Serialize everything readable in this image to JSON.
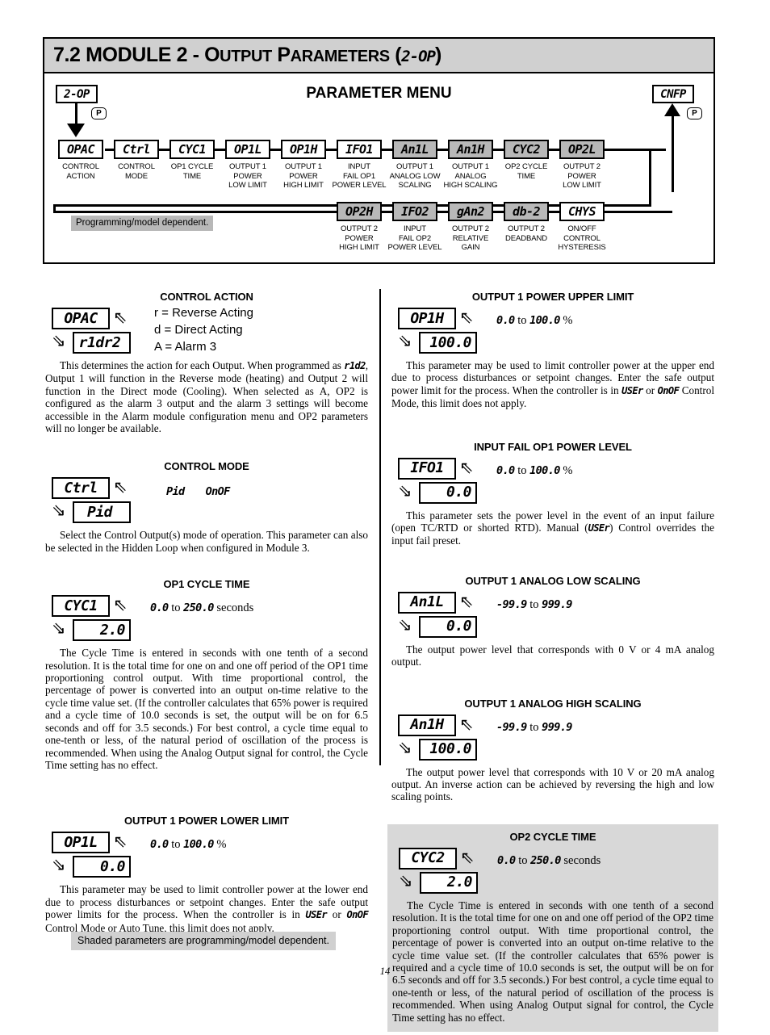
{
  "header": {
    "number": "7.2",
    "title_main": "MODULE 2 - ",
    "title_sc1": "O",
    "title_sc1b": "UTPUT",
    "title_sc2": "P",
    "title_sc2b": "ARAMETERS",
    "paren_open": "(",
    "code": "2-OP",
    "paren_close": ")"
  },
  "diagram": {
    "title": "PARAMETER MENU",
    "entry_box": "2-OP",
    "exit_box": "CNFP",
    "p_button": "P",
    "note": "Programming/model dependent.",
    "row1": [
      {
        "code": "OPAC",
        "label": "CONTROL\nACTION",
        "shaded": false
      },
      {
        "code": "Ctrl",
        "label": "CONTROL\nMODE",
        "shaded": false
      },
      {
        "code": "CYC1",
        "label": "OP1 CYCLE\nTIME",
        "shaded": false
      },
      {
        "code": "OP1L",
        "label": "OUTPUT 1\nPOWER\nLOW LIMIT",
        "shaded": false
      },
      {
        "code": "OP1H",
        "label": "OUTPUT 1\nPOWER\nHIGH LIMIT",
        "shaded": false
      },
      {
        "code": "IFO1",
        "label": "INPUT\nFAIL OP1\nPOWER LEVEL",
        "shaded": false
      },
      {
        "code": "An1L",
        "label": "OUTPUT 1\nANALOG LOW\nSCALING",
        "shaded": true
      },
      {
        "code": "An1H",
        "label": "OUTPUT 1\nANALOG\nHIGH SCALING",
        "shaded": true
      },
      {
        "code": "CYC2",
        "label": "OP2 CYCLE\nTIME",
        "shaded": true
      },
      {
        "code": "OP2L",
        "label": "OUTPUT 2\nPOWER\nLOW LIMIT",
        "shaded": true
      }
    ],
    "row2": [
      {
        "code": "OP2H",
        "label": "OUTPUT 2\nPOWER\nHIGH LIMIT",
        "shaded": true
      },
      {
        "code": "IFO2",
        "label": "INPUT\nFAIL OP2\nPOWER LEVEL",
        "shaded": true
      },
      {
        "code": "gAn2",
        "label": "OUTPUT 2\nRELATIVE\nGAIN",
        "shaded": true
      },
      {
        "code": "db-2",
        "label": "OUTPUT 2\nDEADBAND",
        "shaded": true
      },
      {
        "code": "CHYS",
        "label": "ON/OFF\nCONTROL\nHYSTERESIS",
        "shaded": false
      }
    ]
  },
  "sections": {
    "control_action": {
      "title": "CONTROL ACTION",
      "param_name": "OPAC",
      "param_value": "r1dr2",
      "choices": [
        "r = Reverse Acting",
        "d = Direct Acting",
        "A = Alarm 3"
      ],
      "body_a": "This determines the action for each Output. When programmed as ",
      "body_code": "r1d2",
      "body_b": ", Output 1 will function in the Reverse mode (heating) and Output 2 will function in the Direct mode (Cooling). When selected as A, OP2 is configured as the alarm 3 output and the alarm 3 settings will become accessible in the Alarm module configuration menu and OP2 parameters will no longer be available."
    },
    "control_mode": {
      "title": "CONTROL MODE",
      "param_name": "Ctrl",
      "param_value": "Pid",
      "options": [
        "Pid",
        "OnOF"
      ],
      "body": "Select the Control Output(s) mode of operation. This parameter can also be selected in the Hidden Loop when configured in Module 3."
    },
    "op1_cycle_time": {
      "title": "OP1 CYCLE TIME",
      "param_name": "CYC1",
      "param_value": "2.0",
      "range_low": "0.0",
      "range_mid": " to ",
      "range_high": "250.0",
      "range_unit": " seconds",
      "body": "The Cycle Time is entered in seconds with one tenth of a second resolution. It is the total time for one on and one off period of the OP1 time proportioning control output. With time proportional control, the percentage of power is converted into an output on-time relative to the cycle time value set. (If the controller calculates that 65% power is required and a cycle time of 10.0 seconds is set, the output will be on for 6.5 seconds and off for 3.5 seconds.) For best control, a cycle time equal to one-tenth or less, of the natural period of oscillation of the process is recommended. When using the Analog Output signal for control, the Cycle Time setting has no effect."
    },
    "op1_power_lower": {
      "title": "OUTPUT 1 POWER LOWER LIMIT",
      "param_name": "OP1L",
      "param_value": "0.0",
      "range_low": "0.0",
      "range_mid": " to ",
      "range_high": "100.0",
      "range_unit": " %",
      "body_a": "This parameter may be used to limit controller power at the lower end due to process disturbances or setpoint changes. Enter the safe output power limits for the process. When the controller is in ",
      "body_code1": "USEr",
      "body_b": " or ",
      "body_code2": "OnOF",
      "body_c": " Control Mode or Auto Tune, this limit does not apply."
    },
    "op1_power_upper": {
      "title": "OUTPUT 1 POWER UPPER LIMIT",
      "param_name": "OP1H",
      "param_value": "100.0",
      "range_low": "0.0",
      "range_mid": " to ",
      "range_high": "100.0",
      "range_unit": " %",
      "body_a": "This parameter may be used to limit controller power at the upper end due to process disturbances or setpoint changes. Enter the safe output power limit for the process. When the controller is in ",
      "body_code1": "USEr",
      "body_b": " or ",
      "body_code2": "OnOF",
      "body_c": " Control Mode, this limit does not apply."
    },
    "input_fail_op1": {
      "title": "INPUT FAIL OP1 POWER LEVEL",
      "param_name": "IFO1",
      "param_value": "0.0",
      "range_low": "0.0",
      "range_mid": " to ",
      "range_high": "100.0",
      "range_unit": " %",
      "body_a": "This parameter sets the power level in the event of an input failure (open TC/RTD or shorted RTD). Manual (",
      "body_code1": "USEr",
      "body_b": ") Control overrides the input fail preset."
    },
    "analog_low": {
      "title": "OUTPUT 1 ANALOG LOW SCALING",
      "param_name": "An1L",
      "param_value": "0.0",
      "range_low": "-99.9",
      "range_mid": " to ",
      "range_high": "999.9",
      "range_unit": "",
      "body": "The output power level that corresponds with 0 V or 4 mA analog output."
    },
    "analog_high": {
      "title": "OUTPUT 1 ANALOG HIGH SCALING",
      "param_name": "An1H",
      "param_value": "100.0",
      "range_low": "-99.9",
      "range_mid": " to ",
      "range_high": "999.9",
      "range_unit": "",
      "body": "The output power level that corresponds with 10 V or 20 mA analog output. An inverse action can be achieved by reversing the high and low scaling points."
    },
    "op2_cycle_time": {
      "title": "OP2 CYCLE TIME",
      "param_name": "CYC2",
      "param_value": "2.0",
      "range_low": "0.0",
      "range_mid": " to ",
      "range_high": "250.0",
      "range_unit": " seconds",
      "body": "The Cycle Time is entered in seconds with one tenth of a second resolution. It is the total time for one on and one off period of the OP2 time proportioning control output. With time proportional control, the percentage of power is converted into an output on-time relative to the cycle time value set. (If the controller calculates that 65% power is required and a cycle time of 10.0 seconds is set, the output will be on for 6.5 seconds and off for 3.5 seconds.) For best control, a cycle time equal to one-tenth or less, of the natural period of oscillation of the process is recommended. When using Analog Output signal for control, the Cycle Time setting has no effect."
    }
  },
  "footer": {
    "note": "Shaded parameters are programming/model dependent.",
    "page": "14"
  }
}
